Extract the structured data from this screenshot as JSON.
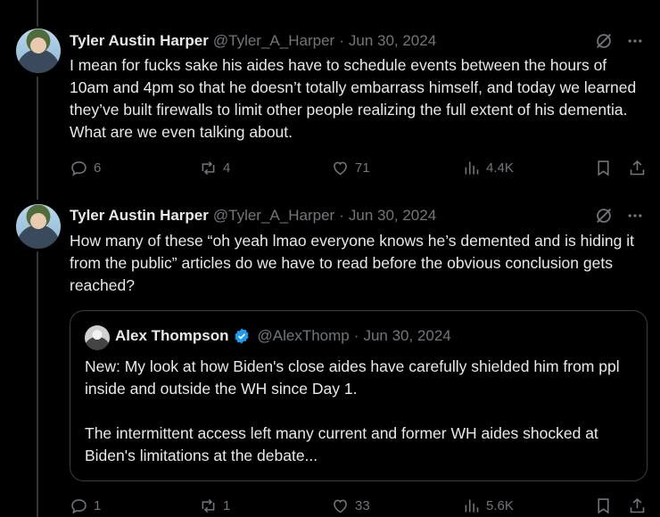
{
  "tweets": [
    {
      "author_name": "Tyler Austin Harper",
      "handle": "@Tyler_A_Harper",
      "separator": "·",
      "date": "Jun 30, 2024",
      "text": "I mean for fucks sake his aides have to schedule events between the hours of 10am and 4pm so that he doesn’t totally embarrass himself, and today we learned they’ve built firewalls to limit other people realizing the full extent of his dementia. What are we even talking about.",
      "replies": "6",
      "reposts": "4",
      "likes": "71",
      "views": "4.4K"
    },
    {
      "author_name": "Tyler Austin Harper",
      "handle": "@Tyler_A_Harper",
      "separator": "·",
      "date": "Jun 30, 2024",
      "text": "How many of these “oh yeah lmao everyone knows he’s demented and is hiding it from the public” articles do we have to read before the obvious conclusion gets reached?",
      "replies": "1",
      "reposts": "1",
      "likes": "33",
      "views": "5.6K",
      "quote": {
        "author_name": "Alex Thompson",
        "handle": "@AlexThomp",
        "separator": "·",
        "date": "Jun 30, 2024",
        "paragraph_1": "New: My look at how Biden's close aides have carefully shielded him from ppl inside and outside the WH since Day 1.",
        "paragraph_2": "The intermittent access left many current and former WH aides shocked at Biden's limitations at the debate..."
      }
    }
  ],
  "icons": {
    "grok": "grok-icon",
    "more": "more-icon",
    "reply": "reply-icon",
    "repost": "repost-icon",
    "like": "like-icon",
    "views": "views-icon",
    "bookmark": "bookmark-icon",
    "share": "share-icon",
    "verified": "verified-badge-icon"
  },
  "colors": {
    "background": "#000000",
    "text": "#e7e9ea",
    "muted": "#71767b",
    "verified": "#1d9bf0"
  }
}
